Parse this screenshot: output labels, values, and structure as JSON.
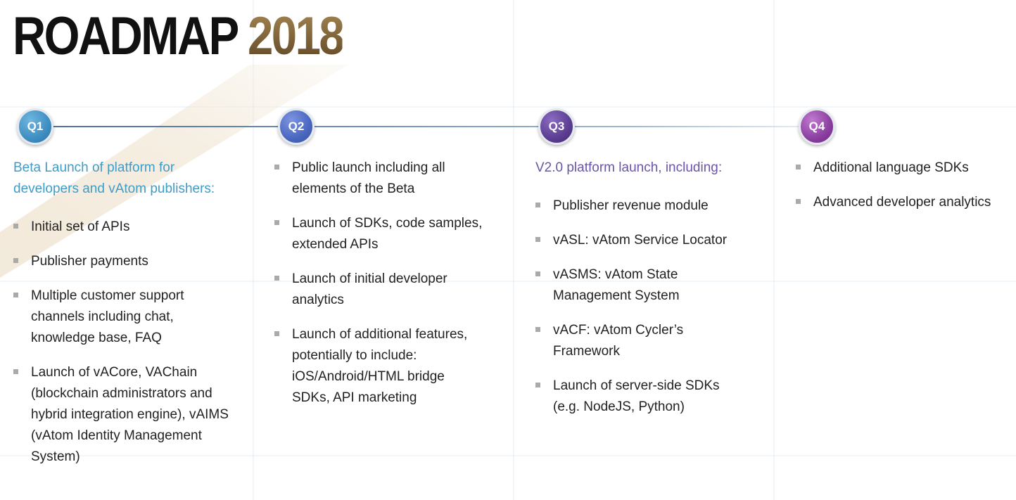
{
  "title": {
    "main": "ROADMAP",
    "year": "2018"
  },
  "colors": {
    "q1": "#3f8ec2",
    "q2": "#4a67c0",
    "q3": "#5b3e92",
    "q4": "#8b3fa0",
    "q1_heading": "#3f9cc7",
    "q3_heading": "#6a55a8",
    "year_gold": "#8b7044",
    "bullet": "#aaaaaa"
  },
  "quarters": [
    {
      "label": "Q1",
      "heading": "Beta Launch of platform for developers and vAtom publishers:",
      "items": [
        "Initial set of APIs",
        "Publisher payments",
        "Multiple customer support channels including chat, knowledge base, FAQ",
        "Launch of vACore, VAChain (blockchain administrators and hybrid integration engine), vAIMS (vAtom Identity Management System)"
      ]
    },
    {
      "label": "Q2",
      "heading": "",
      "items": [
        "Public launch including all elements of the Beta",
        "Launch of SDKs, code samples, extended APIs",
        "Launch of initial developer analytics",
        "Launch of additional features, potentially to include: iOS/Android/HTML bridge SDKs, API marketing"
      ]
    },
    {
      "label": "Q3",
      "heading": "V2.0 platform launch, including:",
      "items": [
        "Publisher revenue module",
        "vASL: vAtom Service Locator",
        "vASMS: vAtom State Management System",
        "vACF: vAtom Cycler’s Framework",
        "Launch of server-side SDKs (e.g. NodeJS, Python)"
      ]
    },
    {
      "label": "Q4",
      "heading": "",
      "items": [
        "Additional language SDKs",
        "Advanced developer analytics"
      ]
    }
  ]
}
